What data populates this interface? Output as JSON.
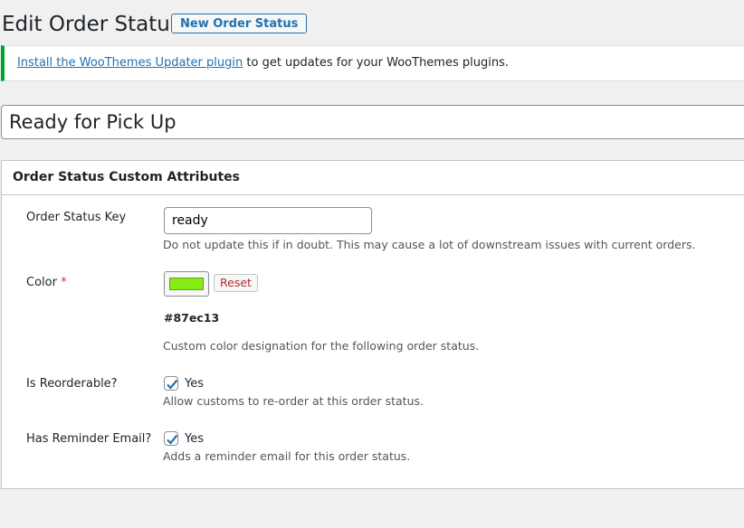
{
  "header": {
    "title": "Edit Order Status",
    "new_button": "New Order Status"
  },
  "notice": {
    "link_text": "Install the WooThemes Updater plugin",
    "text": " to get updates for your WooThemes plugins."
  },
  "post_title": "Ready for Pick Up",
  "metabox": {
    "title": "Order Status Custom Attributes",
    "key": {
      "label": "Order Status Key",
      "value": "ready",
      "description": "Do not update this if in doubt. This may cause a lot of downstream issues with current orders."
    },
    "color": {
      "label": "Color",
      "required_mark": "*",
      "swatch": "#87ec13",
      "reset_label": "Reset",
      "hex": "#87ec13",
      "description": "Custom color designation for the following order status."
    },
    "reorderable": {
      "label": "Is Reorderable?",
      "checked": true,
      "option": "Yes",
      "description": "Allow customs to re-order at this order status."
    },
    "reminder": {
      "label": "Has Reminder Email?",
      "checked": true,
      "option": "Yes",
      "description": "Adds a reminder email for this order status."
    }
  }
}
